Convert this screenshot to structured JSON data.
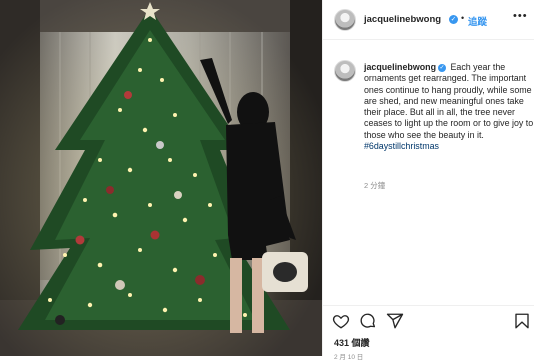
{
  "post": {
    "username": "jacquelinebwong",
    "follow_dot": "•",
    "follow_label": "追蹤",
    "more_icon": "more-horizontal-icon",
    "verified_glyph": "✓",
    "caption_text": "Each year the ornaments get rearranged. The important ones continue to hang proudly, while some are shed, and new meaningful ones take their place. But all in all, the tree never ceases to light up the room or to give joy to those who see the beauty in it.",
    "hashtag": "#6daystillchristmas",
    "time_ago": "2 分鐘",
    "likes_count": "431",
    "likes_label": "個讚",
    "date_label": "2 月 10 日"
  },
  "colors": {
    "accent": "#3897f0",
    "hashtag": "#00376b",
    "muted": "#8e8e8e",
    "text": "#262626"
  },
  "icons": [
    "heart-icon",
    "comment-icon",
    "share-icon",
    "bookmark-icon"
  ]
}
